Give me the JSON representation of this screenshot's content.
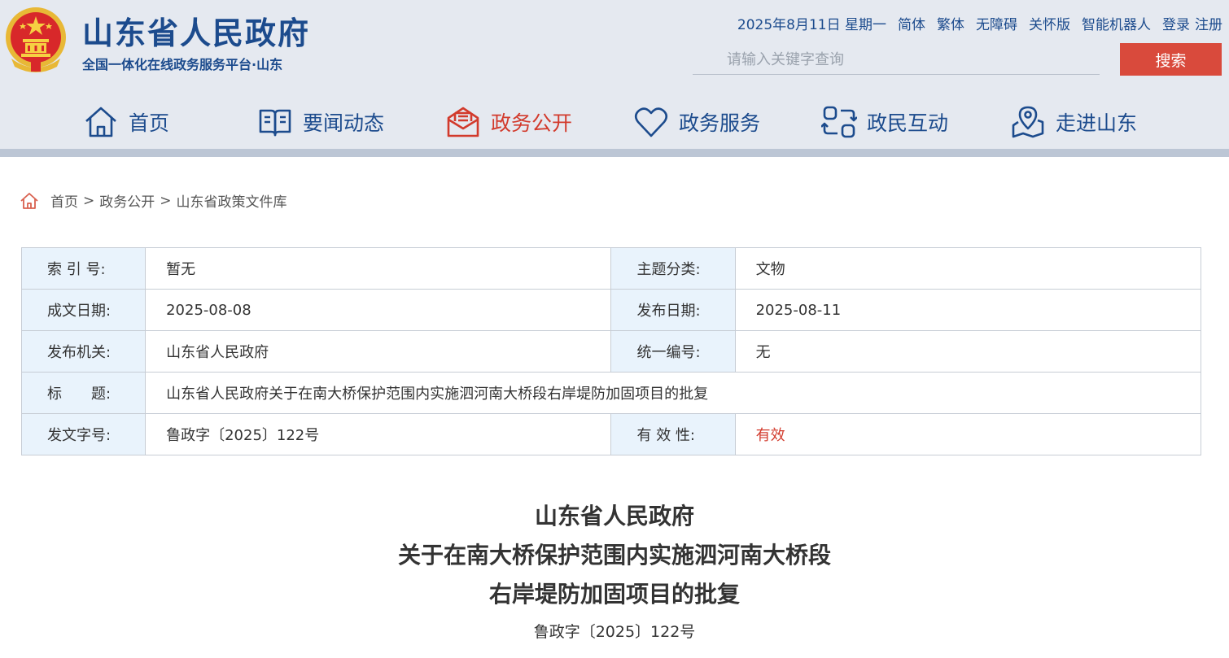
{
  "header": {
    "site_title": "山东省人民政府",
    "site_subtitle": "全国一体化在线政务服务平台·山东",
    "date": "2025年8月11日 星期一",
    "links": [
      "简体",
      "繁体",
      "无障碍",
      "关怀版",
      "智能机器人"
    ],
    "login": "登录",
    "register": "注册",
    "search_placeholder": "请输入关键字查询",
    "search_button": "搜索"
  },
  "nav": {
    "items": [
      {
        "label": "首页",
        "icon": "home-icon"
      },
      {
        "label": "要闻动态",
        "icon": "book-icon"
      },
      {
        "label": "政务公开",
        "icon": "mail-icon",
        "active": true
      },
      {
        "label": "政务服务",
        "icon": "heart-icon"
      },
      {
        "label": "政民互动",
        "icon": "interaction-icon"
      },
      {
        "label": "走进山东",
        "icon": "location-icon"
      }
    ]
  },
  "breadcrumb": [
    "首页",
    "政务公开",
    "山东省政策文件库"
  ],
  "meta": {
    "index_label": "索 引 号:",
    "index_value": "暂无",
    "topic_label": "主题分类:",
    "topic_value": "文物",
    "written_label": "成文日期:",
    "written_value": "2025-08-08",
    "publish_label": "发布日期:",
    "publish_value": "2025-08-11",
    "issuer_label": "发布机关:",
    "issuer_value": "山东省人民政府",
    "serial_label": "统一编号:",
    "serial_value": "无",
    "title_label": "标　　题:",
    "title_value": "山东省人民政府关于在南大桥保护范围内实施泗河南大桥段右岸堤防加固项目的批复",
    "docno_label": "发文字号:",
    "docno_value": "鲁政字〔2025〕122号",
    "validity_label": "有 效 性:",
    "validity_value": "有效"
  },
  "document": {
    "title_lines": [
      "山东省人民政府",
      "关于在南大桥保护范围内实施泗河南大桥段",
      "右岸堤防加固项目的批复"
    ],
    "doc_number": "鲁政字〔2025〕122号"
  },
  "colors": {
    "brand_blue": "#1c4b8d",
    "accent_red": "#d23a2c",
    "search_button": "#d94a3c",
    "label_cell_bg": "#e9f3fc"
  }
}
